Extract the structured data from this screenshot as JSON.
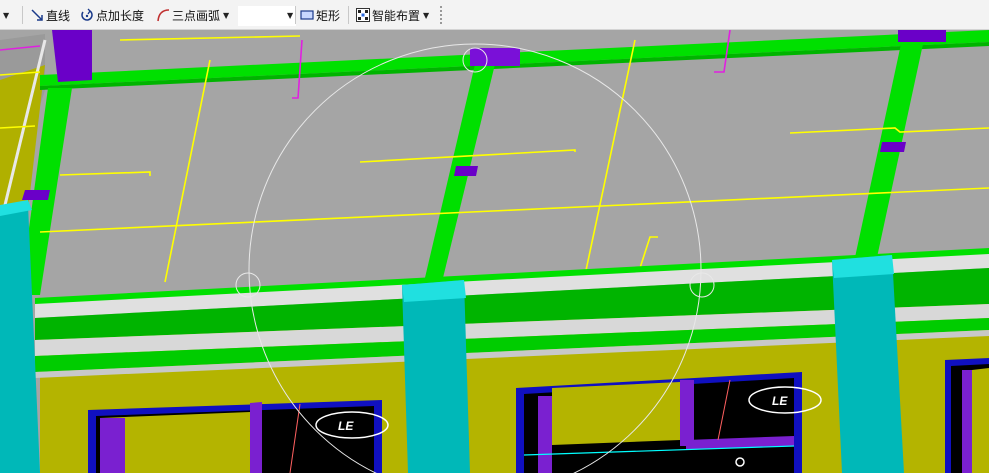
{
  "toolbar": {
    "cut_label": "",
    "line_label": "直线",
    "point_length_label": "点加长度",
    "three_point_arc_label": "三点画弧",
    "arc_combo_value": "",
    "rect_label": "矩形",
    "smart_layout_label": "智能布置"
  },
  "icons": {
    "line": "diagonal-arrow-icon",
    "point_length": "circular-arrow-icon",
    "arc": "arc-icon",
    "rect": "rectangle-icon",
    "smart": "grid-dots-icon"
  },
  "viewport": {
    "window_label_1": "LE",
    "window_label_2": "LE"
  },
  "colors": {
    "slab": "#a5a5a5",
    "beam": "#00e000",
    "beam_dark": "#00b400",
    "column": "#00c4c4",
    "wall": "#b4b400",
    "purple": "#6a00c8",
    "line_yellow": "#ffff00",
    "line_magenta": "#e020e0",
    "window_blue": "#1010c0"
  }
}
